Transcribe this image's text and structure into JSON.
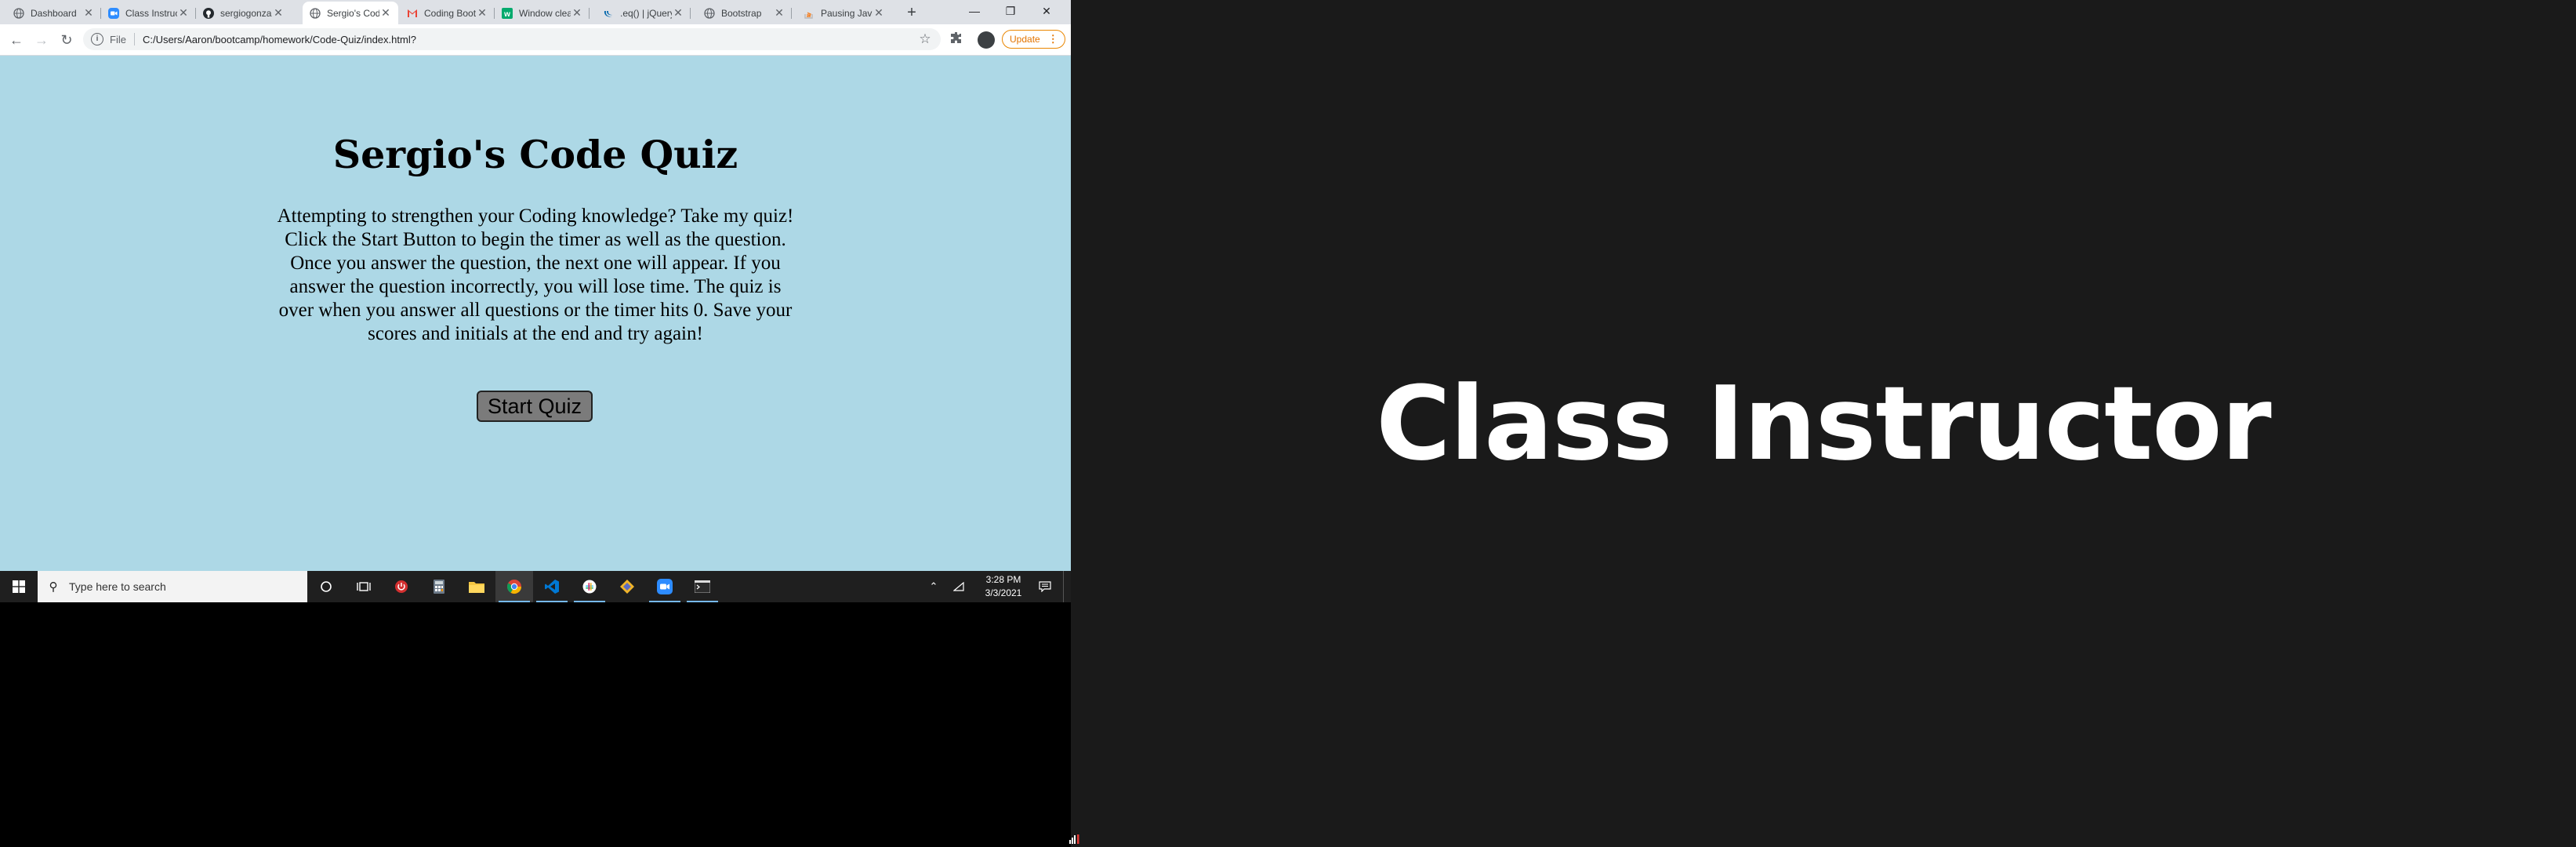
{
  "browser": {
    "tabs": [
      {
        "title": "Dashboard",
        "icon": "globe-icon"
      },
      {
        "title": "Class Instructor",
        "icon": "zoom-icon"
      },
      {
        "title": "sergiogonzalez",
        "icon": "github-icon"
      },
      {
        "title": "Sergio's Code Quiz",
        "icon": "globe-icon",
        "active": true
      },
      {
        "title": "Coding Bootcamp",
        "icon": "gmail-icon"
      },
      {
        "title": "Window clearInterval",
        "icon": "w3schools-icon"
      },
      {
        "title": ".eq() | jQuery",
        "icon": "jquery-icon"
      },
      {
        "title": "Bootstrap",
        "icon": "globe-icon"
      },
      {
        "title": "Pausing JavaScript",
        "icon": "stackoverflow-icon"
      }
    ],
    "new_tab": "+",
    "address": {
      "scheme_label": "File",
      "url": "C:/Users/Aaron/bootcamp/homework/Code-Quiz/index.html?"
    },
    "update_label": "Update"
  },
  "page": {
    "title": "Sergio's Code Quiz",
    "description": "Attempting to strengthen your Coding knowledge? Take my quiz! Click the Start Button to begin the timer as well as the question. Once you answer the question, the next one will appear. If you answer the question incorrectly, you will lose time. The quiz is over when you answer all questions or the timer hits 0. Save your scores and initials at the end and try again!",
    "start_button": "Start Quiz",
    "background_color": "#add8e6"
  },
  "taskbar": {
    "search_placeholder": "Type here to search",
    "clock": {
      "time": "3:28 PM",
      "date": "3/3/2021"
    }
  },
  "video": {
    "participant_name": "Class Instructor"
  }
}
